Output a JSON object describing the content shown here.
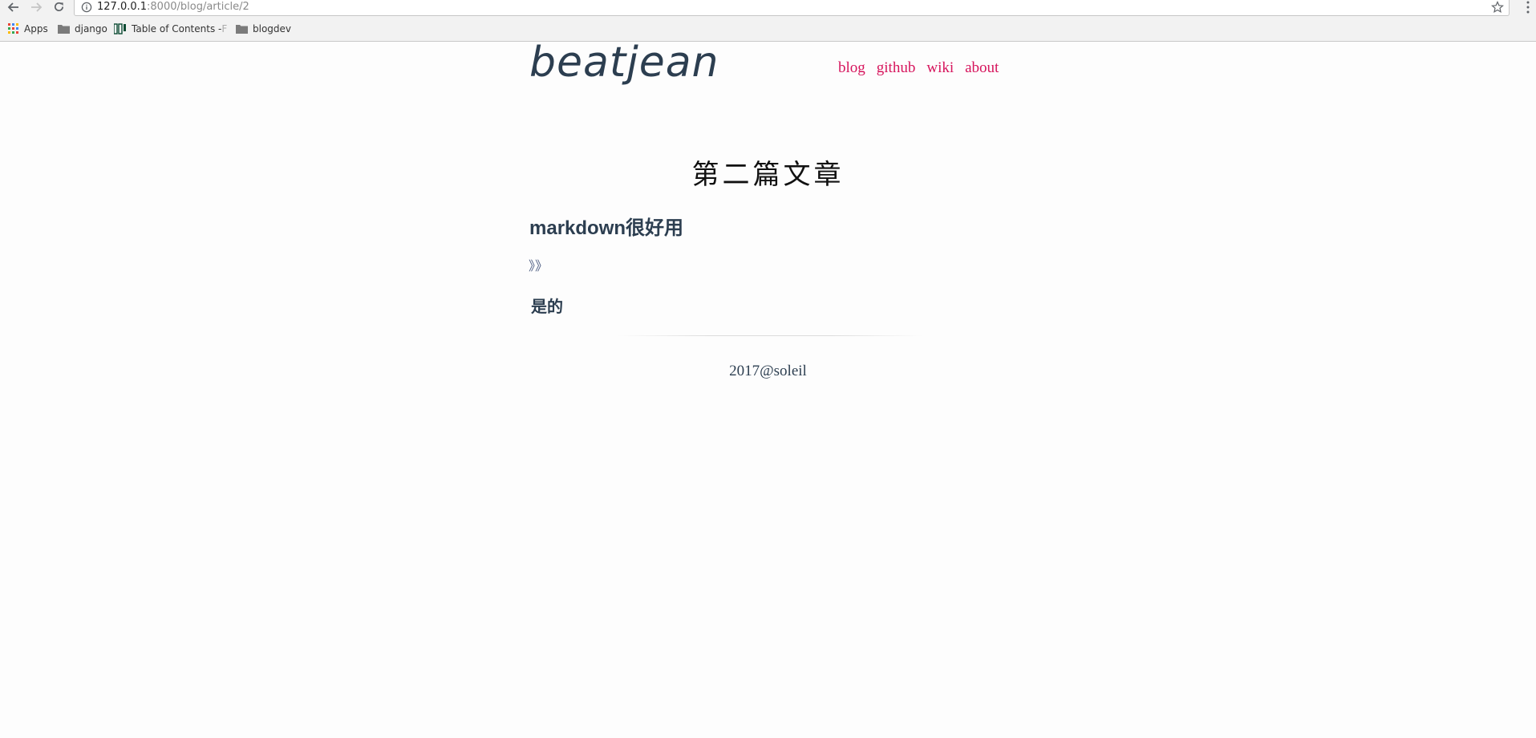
{
  "browser": {
    "url_host": "127.0.0.1",
    "url_path": ":8000/blog/article/2",
    "bookmarks": [
      {
        "label": "Apps",
        "icon": "apps-grid-icon"
      },
      {
        "label": "django",
        "icon": "folder-icon"
      },
      {
        "label": "Table of Contents -",
        "label_fade": " F",
        "icon": "django-docs-icon"
      },
      {
        "label": "blogdev",
        "icon": "folder-icon"
      }
    ]
  },
  "site": {
    "title": "beatjean",
    "nav": [
      "blog",
      "github",
      "wiki",
      "about"
    ],
    "accent_color": "#d6145c",
    "text_color": "#2c3e50"
  },
  "article": {
    "title": "第二篇文章",
    "heading": "markdown很好用",
    "quote": "》》",
    "subheading": "是的"
  },
  "footer": {
    "text": "2017@soleil"
  }
}
